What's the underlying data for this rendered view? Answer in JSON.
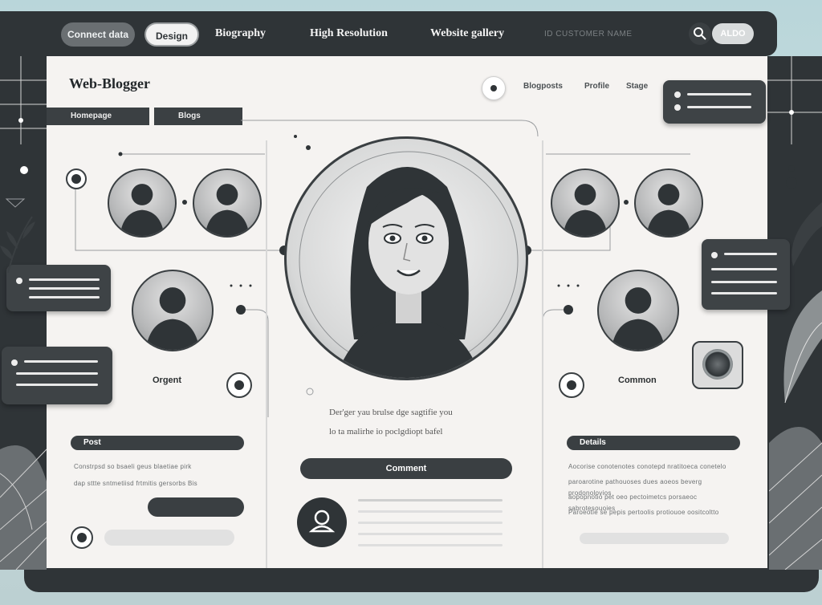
{
  "nav": {
    "pill_active": "Connect data",
    "pill_light": "Design",
    "links": [
      "Biography",
      "High Resolution",
      "Website gallery"
    ],
    "faint": "ID CUSTOMER NAME",
    "login": "ALDO"
  },
  "header": {
    "brand": "Web-Blogger",
    "tabs": [
      "Homepage",
      "Blogs"
    ],
    "links": [
      "Blogposts",
      "Profile",
      "Stage"
    ]
  },
  "profiles": {
    "left_label": "Orgent",
    "right_label": "Common"
  },
  "center": {
    "text_line1": "Der'ger yau brulse dge sagtifie you",
    "text_line2": "lo ta malirhe io poclgdiopt bafel",
    "cta": "Comment"
  },
  "left_panel": {
    "title": "Post",
    "line1": "Constrpsd so bsaeli geus blaetiae pirk",
    "line2": "dap sttte sntmetiisd frtmitis gersorbs Bis"
  },
  "right_panel": {
    "title": "Details",
    "line1": "Aocorise conotenotes conotepd nratitoeca conetelo",
    "line2": "paroarotine pathouoses dues aoeos beverg prodonolovios",
    "line3": "aopopnotio pet oeo pectoimetcs porsaeoc sabrotesouoies",
    "line4": "Paroeotie se pepis pertoolis protiouoe oositcoltto"
  },
  "icons": [
    "search-icon",
    "user-icon",
    "silhouette-icon",
    "camera-icon",
    "leaf-icon",
    "target-icon"
  ]
}
